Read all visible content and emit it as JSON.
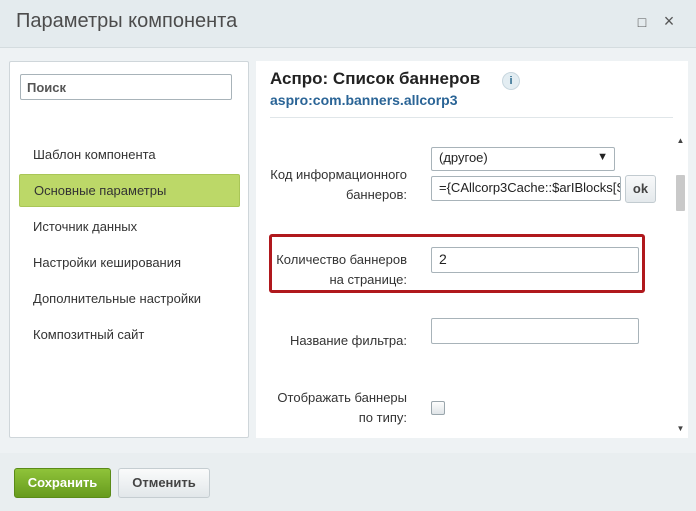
{
  "window": {
    "title": "Параметры компонента",
    "minimize_symbol": "□",
    "close_symbol": "×"
  },
  "sidebar": {
    "search_placeholder": "Поиск",
    "items": [
      {
        "label": "Шаблон компонента",
        "active": false
      },
      {
        "label": "Основные параметры",
        "active": true
      },
      {
        "label": "Источник данных",
        "active": false
      },
      {
        "label": "Настройки кеширования",
        "active": false
      },
      {
        "label": "Дополнительные настройки",
        "active": false
      },
      {
        "label": "Композитный сайт",
        "active": false
      }
    ]
  },
  "component": {
    "title": "Аспро: Список баннеров",
    "info_symbol": "i",
    "code": "aspro:com.banners.allcorp3"
  },
  "form": {
    "iblock": {
      "label_line1": "Код информационного",
      "label_line2": "баннеров:",
      "select_value": "(другое)",
      "input_value": "={CAllcorp3Cache::$arIBlocks[S",
      "ok_label": "ok"
    },
    "count": {
      "label_line1": "Количество баннеров",
      "label_line2": "на странице:",
      "value": "2"
    },
    "filter": {
      "label": "Название фильтра:",
      "value": ""
    },
    "by_type": {
      "label_line1": "Отображать баннеры",
      "label_line2": "по типу:",
      "checked": false
    }
  },
  "footer": {
    "save_label": "Сохранить",
    "cancel_label": "Отменить"
  },
  "colors": {
    "active_item": "#bcd868",
    "save_button": "#7cb030",
    "highlight_border": "#b0181d",
    "link_blue": "#2a6496"
  }
}
